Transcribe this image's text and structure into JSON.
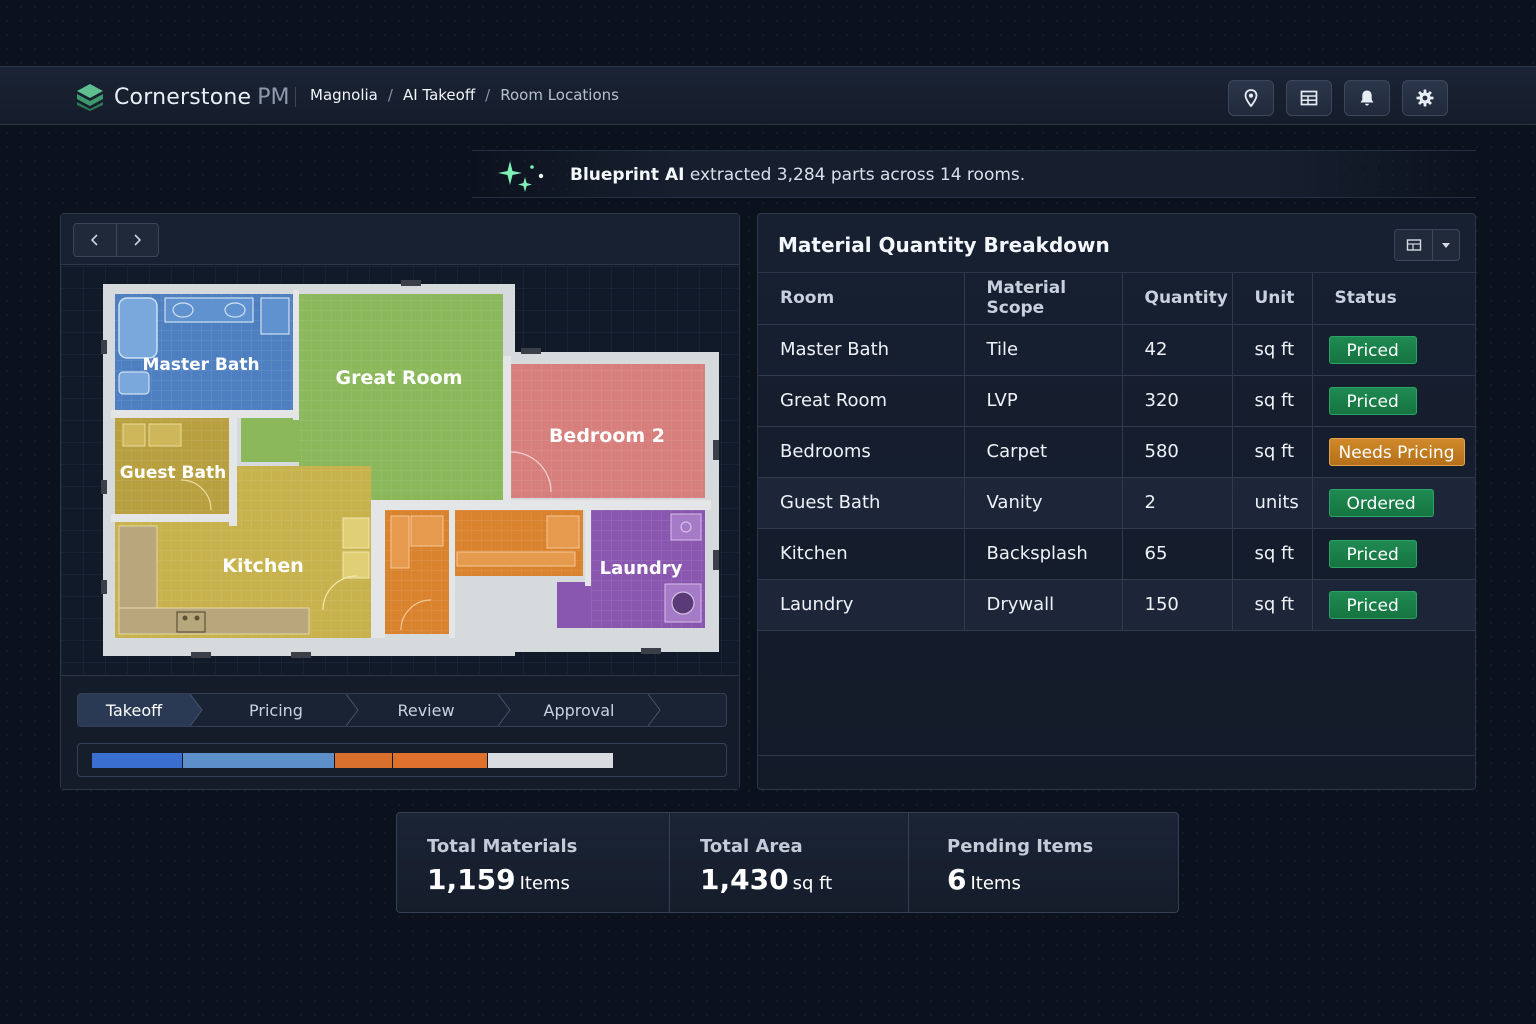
{
  "app": {
    "brand": "Cornerstone",
    "brand_suffix": "PM",
    "breadcrumb": [
      "Magnolia",
      "AI Takeoff",
      "Room Locations"
    ],
    "toolbar_icons": [
      "map-pin-icon",
      "table-icon",
      "bell-icon",
      "gear-icon"
    ]
  },
  "banner": {
    "strong": "Blueprint AI",
    "text": " extracted 3,284 parts across 14 rooms."
  },
  "floorplan": {
    "rooms": {
      "master_bath": "Master Bath",
      "great_room": "Great Room",
      "bedroom_2": "Bedroom 2",
      "guest_bath": "Guest Bath",
      "kitchen": "Kitchen",
      "laundry": "Laundry"
    }
  },
  "workflow": {
    "steps": [
      "Takeoff",
      "Pricing",
      "Review",
      "Approval"
    ],
    "active": "Takeoff"
  },
  "progress": {
    "segments": [
      {
        "value": 0.172,
        "color": "#3a6fcf"
      },
      {
        "value": 0.293,
        "color": "#5d8fca"
      },
      {
        "value": 0.111,
        "color": "#d9702e"
      },
      {
        "value": 0.182,
        "color": "#e0712c"
      },
      {
        "value": 0.242,
        "color": "#d8dbe0"
      }
    ]
  },
  "table": {
    "title": "Material Quantity Breakdown",
    "columns": [
      "Room",
      "Material Scope",
      "Quantity",
      "Unit",
      "Status"
    ],
    "rows": [
      {
        "room": "Master Bath",
        "scope": "Tile",
        "qty": "42",
        "unit": "sq ft",
        "status": "Priced",
        "tone": "green"
      },
      {
        "room": "Great Room",
        "scope": "LVP",
        "qty": "320",
        "unit": "sq ft",
        "status": "Priced",
        "tone": "green"
      },
      {
        "room": "Bedrooms",
        "scope": "Carpet",
        "qty": "580",
        "unit": "sq ft",
        "status": "Needs Pricing",
        "tone": "orange"
      },
      {
        "room": "Guest Bath",
        "scope": "Vanity",
        "qty": "2",
        "unit": "units",
        "status": "Ordered",
        "tone": "green"
      },
      {
        "room": "Kitchen",
        "scope": "Backsplash",
        "qty": "65",
        "unit": "sq ft",
        "status": "Priced",
        "tone": "green"
      },
      {
        "room": "Laundry",
        "scope": "Drywall",
        "qty": "150",
        "unit": "sq ft",
        "status": "Priced",
        "tone": "green"
      }
    ]
  },
  "summary": [
    {
      "label": "Total Materials",
      "value": "1,159",
      "unit": "Items"
    },
    {
      "label": "Total Area",
      "value": "1,430",
      "unit": "sq ft"
    },
    {
      "label": "Pending Items",
      "value": "6",
      "unit": "Items"
    }
  ],
  "colors": {
    "accent": "#3a6fcf",
    "priced": "#1f8a52",
    "needs_pricing": "#d08a2a"
  }
}
